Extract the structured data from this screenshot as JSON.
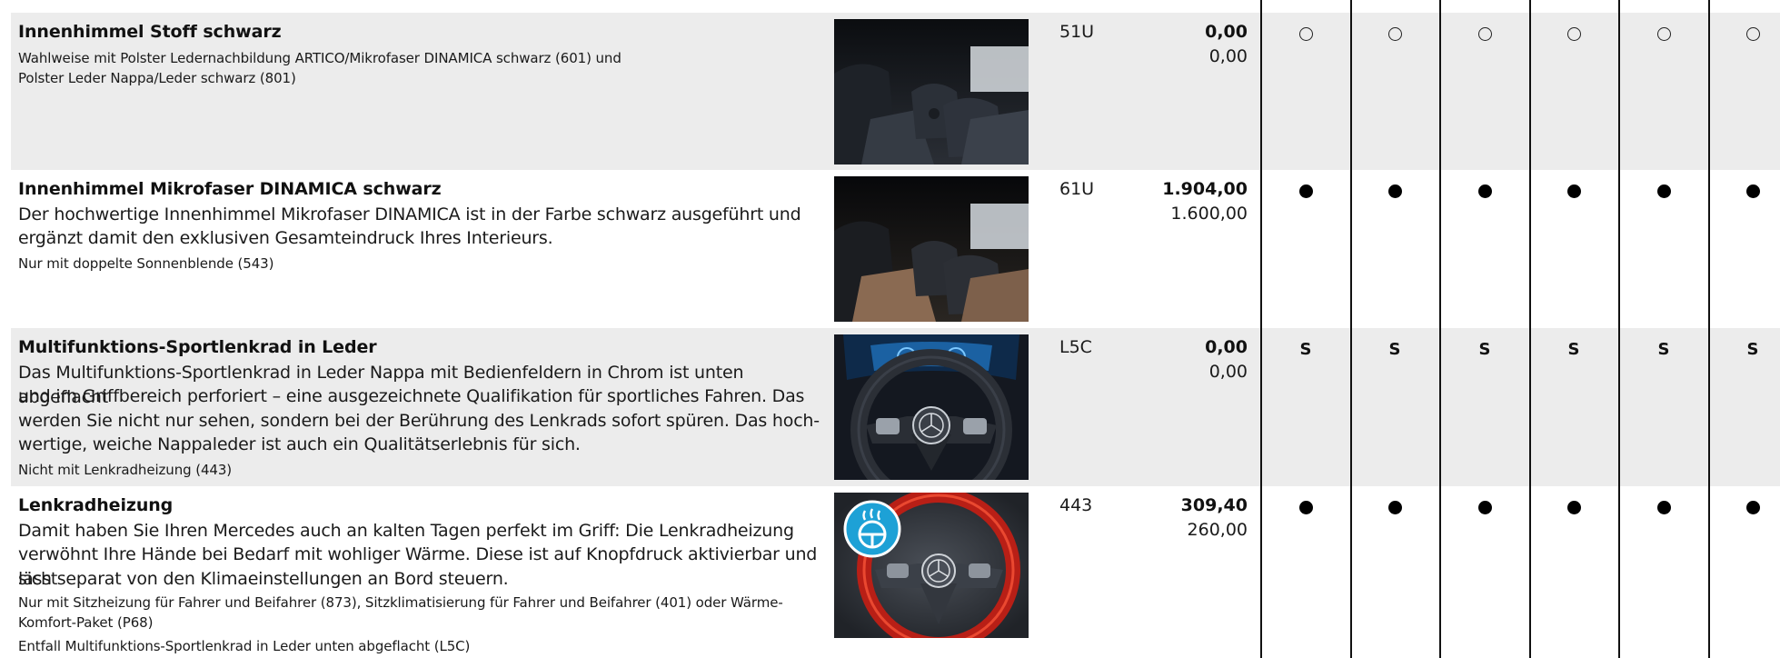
{
  "rows": [
    {
      "title": "Innenhimmel Stoff schwarz",
      "lines": [],
      "notes": [
        "Wahlweise mit Polster Ledernachbildung ARTICO/Mikrofaser DINAMICA schwarz (601) und",
        "Polster Leder Nappa/Leder schwarz (801)"
      ],
      "image": "interior-rear-seats-dark-photo",
      "code": "51U",
      "price_gross": "0,00",
      "price_net": "0,00",
      "availability": "optional-open-circle",
      "marks": [
        "",
        "",
        "",
        "",
        "",
        ""
      ]
    },
    {
      "title": "Innenhimmel Mikrofaser DINAMICA schwarz",
      "lines": [
        "Der hochwertige Innenhimmel Mikrofaser DINAMICA ist in der Farbe schwarz ausgeführt und",
        "ergänzt damit den exklusiven Gesamteindruck Ihres Interieurs."
      ],
      "notes": [
        "Nur mit doppelte Sonnenblende (543)"
      ],
      "image": "interior-rear-seats-brown-photo",
      "code": "61U",
      "price_gross": "1.904,00",
      "price_net": "1.600,00",
      "availability": "optional-filled-circle",
      "marks": [
        "",
        "",
        "",
        "",
        "",
        ""
      ]
    },
    {
      "title": "Multifunktions-Sportlenkrad in Leder",
      "lines": [
        "Das Multifunktions-Sportlenkrad in Leder Nappa mit Bedienfeldern in Chrom ist unten abgeflacht",
        "und im Griffbereich perforiert – eine ausgezeichnete Qualifikation für sportliches Fahren. Das",
        "werden Sie nicht nur sehen, sondern bei der Berührung des Lenkrads sofort spüren. Das hoch-",
        "wertige, weiche Nappaleder ist auch ein Qualitätserlebnis für sich."
      ],
      "notes": [
        "Nicht mit Lenkradheizung (443)"
      ],
      "image": "steering-wheel-cockpit-photo",
      "code": "L5C",
      "price_gross": "0,00",
      "price_net": "0,00",
      "availability": "standard",
      "marks": [
        "S",
        "S",
        "S",
        "S",
        "S",
        "S"
      ]
    },
    {
      "title": "Lenkradheizung",
      "lines": [
        "Damit haben Sie Ihren Mercedes auch an kalten Tagen perfekt im Griff: Die Lenkradheizung",
        "verwöhnt Ihre Hände bei Bedarf mit wohliger Wärme. Diese ist auf Knopfdruck aktivierbar und lässt",
        "sich separat von den Klimaeinstellungen an Bord steuern."
      ],
      "notes": [
        "Nur mit Sitzheizung für Fahrer und Beifahrer (873), Sitzklimatisierung für Fahrer und Beifahrer (401) oder Wärme-",
        "Komfort-Paket (P68)",
        "Entfall Multifunktions-Sportlenkrad in Leder unten abgeflacht (L5C)"
      ],
      "image": "heated-steering-wheel-photo",
      "code": "443",
      "price_gross": "309,40",
      "price_net": "260,00",
      "availability": "optional-filled-circle",
      "marks": [
        "",
        "",
        "",
        "",
        "",
        ""
      ]
    }
  ],
  "colors": {
    "row_shade": "#ececec",
    "text": "#111111",
    "heat_ring": "#d9261c",
    "heat_badge": "#1da1d6"
  }
}
